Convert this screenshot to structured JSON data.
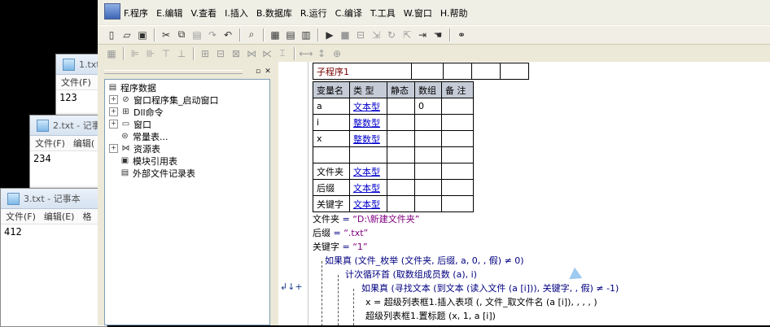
{
  "notepads": [
    {
      "title": "1.txt",
      "menus": [
        "文件(F)"
      ],
      "content": "123"
    },
    {
      "title": "2.txt - 记事",
      "menus": [
        "文件(F)",
        "编辑("
      ],
      "content": "234"
    },
    {
      "title": "3.txt - 记事本",
      "menus": [
        "文件(F)",
        "编辑(E)",
        "格"
      ],
      "content": "412"
    }
  ],
  "menubar": {
    "items": [
      "F.程序",
      "E.编辑",
      "V.查看",
      "I.插入",
      "B.数据库",
      "R.运行",
      "C.编译",
      "T.工具",
      "W.窗口",
      "H.帮助"
    ]
  },
  "tree": {
    "root": "程序数据",
    "items": [
      "窗口程序集_启动窗口",
      "Dll命令",
      "窗口",
      "常量表...",
      "资源表",
      "模块引用表",
      "外部文件记录表"
    ]
  },
  "sub_table": {
    "header": "子程序1"
  },
  "var_table": {
    "headers": [
      "变量名",
      "类 型",
      "静态",
      "数组",
      "备 注"
    ],
    "rows": [
      {
        "name": "a",
        "type": "文本型",
        "static": "",
        "array": "0",
        "note": ""
      },
      {
        "name": "i",
        "type": "整数型",
        "static": "",
        "array": "",
        "note": ""
      },
      {
        "name": "x",
        "type": "整数型",
        "static": "",
        "array": "",
        "note": ""
      },
      {
        "name": "",
        "type": "",
        "static": "",
        "array": "",
        "note": ""
      },
      {
        "name": "文件夹",
        "type": "文本型",
        "static": "",
        "array": "",
        "note": ""
      },
      {
        "name": "后缀",
        "type": "文本型",
        "static": "",
        "array": "",
        "note": ""
      },
      {
        "name": "关键字",
        "type": "文本型",
        "static": "",
        "array": "",
        "note": ""
      }
    ]
  },
  "code": {
    "l1_var": "文件夹",
    "l1_op": " = ",
    "l1_val": "“D:\\新建文件夹”",
    "l2_var": "后缀",
    "l2_op": " = ",
    "l2_val": "“.txt”",
    "l3_var": "关键字",
    "l3_op": " = ",
    "l3_val": "“1”",
    "l4": "如果真 (文件_枚举 (文件夹, 后缀, a, 0, , 假) ≠ 0)",
    "l5": "计次循环首 (取数组成员数 (a), i)",
    "l6": "如果真 (寻找文本 (到文本 (读入文件 (a [i])), 关键字, , 假) ≠ -1)",
    "l7": "x = 超级列表框1.插入表项 (, 文件_取文件名 (a [i]), , , , )",
    "l8": "超级列表框1.置标题 (x, 1, a [i])"
  },
  "gutter": {
    "fold_symbol": "↲↓+"
  }
}
